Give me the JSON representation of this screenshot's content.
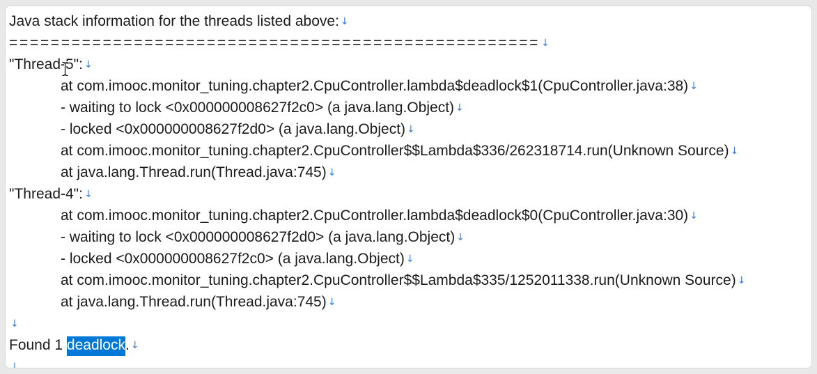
{
  "document": {
    "line_break_mark": "↓",
    "heading": "Java stack information for the threads listed above:",
    "separator": "===================================================",
    "threads": [
      {
        "name": "\"Thread-5\":",
        "frames": [
          "at com.imooc.monitor_tuning.chapter2.CpuController.lambda$deadlock$1(CpuController.java:38)",
          "- waiting to lock <0x000000008627f2c0> (a java.lang.Object)",
          "- locked <0x000000008627f2d0> (a java.lang.Object)",
          "at com.imooc.monitor_tuning.chapter2.CpuController$$Lambda$336/262318714.run(Unknown Source)",
          "at java.lang.Thread.run(Thread.java:745)"
        ]
      },
      {
        "name": "\"Thread-4\":",
        "frames": [
          "at com.imooc.monitor_tuning.chapter2.CpuController.lambda$deadlock$0(CpuController.java:30)",
          "- waiting to lock <0x000000008627f2d0> (a java.lang.Object)",
          "- locked <0x000000008627f2c0> (a java.lang.Object)",
          "at com.imooc.monitor_tuning.chapter2.CpuController$$Lambda$335/1252011338.run(Unknown Source)",
          "at java.lang.Thread.run(Thread.java:745)"
        ]
      }
    ],
    "summary": {
      "prefix": "Found 1 ",
      "selected": "deadlock",
      "suffix": "."
    }
  },
  "icons": {
    "mouse_pointer": "ibeam-cursor-icon"
  },
  "colors": {
    "text": "#1b1b1b",
    "format_mark": "#3d7ad6",
    "selection_background": "#0078d7",
    "selection_text": "#ffffff",
    "page_background": "#ffffff",
    "frame_background": "#e8e8e8"
  }
}
